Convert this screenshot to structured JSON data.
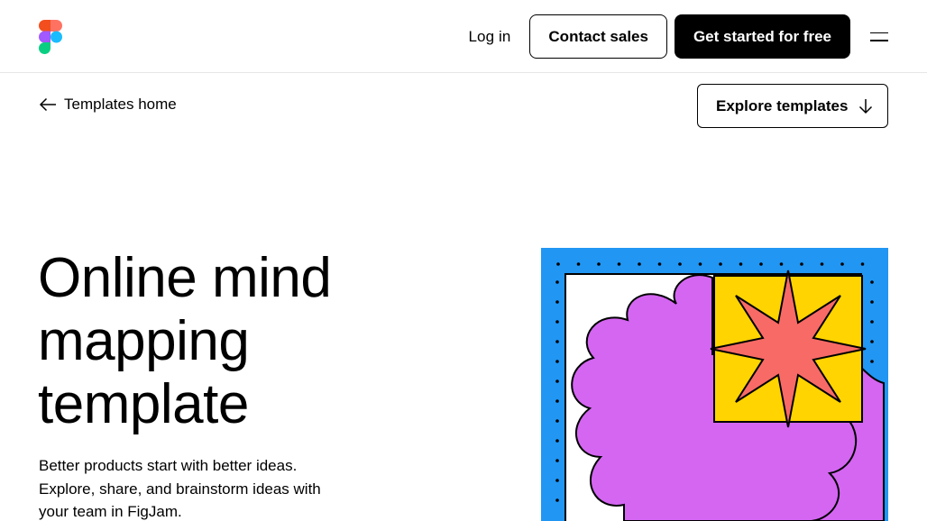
{
  "header": {
    "login_label": "Log in",
    "contact_label": "Contact sales",
    "cta_label": "Get started for free",
    "logo_icon": "figma-logo-icon",
    "menu_icon": "hamburger-menu-icon"
  },
  "breadcrumb": {
    "label": "Templates home",
    "icon": "arrow-left-icon"
  },
  "explore": {
    "label": "Explore templates",
    "icon": "arrow-down-icon"
  },
  "hero": {
    "title": "Online mind mapping template",
    "description": "Better products start with better ideas. Explore, share, and brainstorm ideas with your team in FigJam."
  },
  "colors": {
    "art_background": "#2196F3",
    "cloud": "#D466F2",
    "square": "#FFD400",
    "star": "#F86A66",
    "figma_red": "#F24E1E",
    "figma_orange": "#FF7262",
    "figma_purple": "#A259FF",
    "figma_blue": "#1ABCFE",
    "figma_green": "#0ACF83"
  }
}
